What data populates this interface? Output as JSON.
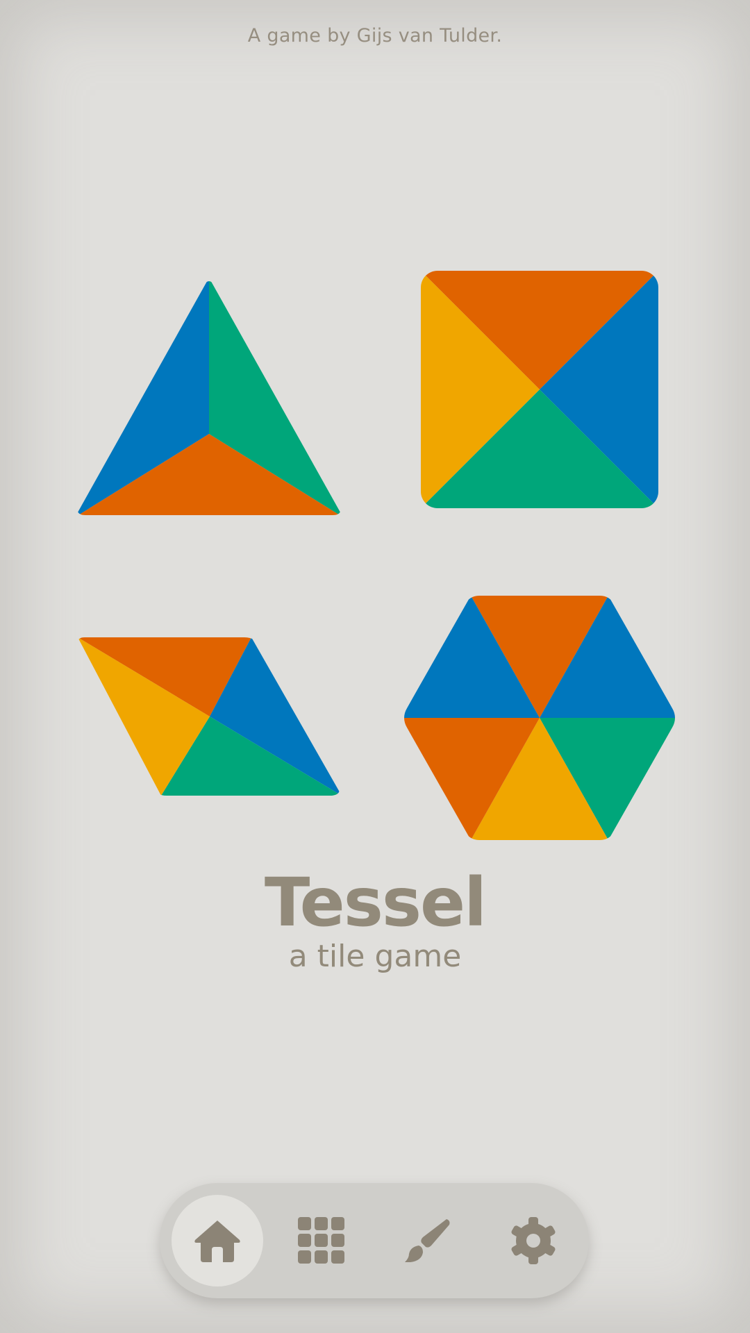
{
  "credit_text": "A game by Gijs van Tulder.",
  "title": "Tessel",
  "subtitle": "a tile game",
  "colors": {
    "background": "#e0dfdc",
    "text": "#928a7a",
    "icon": "#8c8476",
    "navbar": "#cfceca",
    "active_button": "#e3e2de",
    "blue": "#0077bd",
    "green": "#00a67a",
    "orange": "#e06300",
    "yellow": "#f0a600"
  },
  "tiles": [
    {
      "shape": "triangle",
      "segments": [
        "blue",
        "green",
        "orange"
      ]
    },
    {
      "shape": "square",
      "segments": [
        "orange",
        "blue",
        "green",
        "yellow"
      ]
    },
    {
      "shape": "rhombus",
      "segments": [
        "orange",
        "blue",
        "green",
        "yellow"
      ]
    },
    {
      "shape": "hexagon",
      "segments": [
        "orange",
        "blue",
        "green",
        "yellow",
        "orange",
        "blue"
      ]
    }
  ],
  "nav": {
    "items": [
      {
        "name": "home",
        "icon": "home-icon",
        "active": true
      },
      {
        "name": "levels",
        "icon": "grid-icon",
        "active": false
      },
      {
        "name": "paint",
        "icon": "paintbrush-icon",
        "active": false
      },
      {
        "name": "settings",
        "icon": "gear-icon",
        "active": false
      }
    ]
  }
}
